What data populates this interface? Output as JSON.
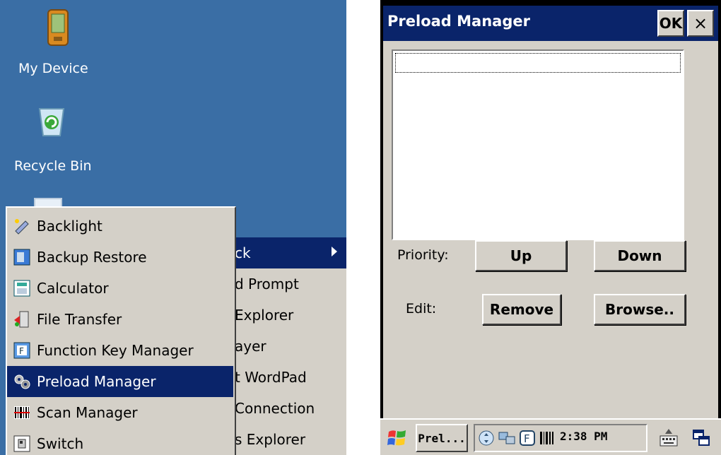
{
  "desktop": {
    "icons": [
      {
        "label": "My Device",
        "icon": "pda-icon"
      },
      {
        "label": "Recycle Bin",
        "icon": "recycle-bin-icon"
      }
    ]
  },
  "submenu": {
    "items": [
      "ck",
      "d Prompt",
      "Explorer",
      "ayer",
      "t WordPad",
      "Connection",
      "s Explorer"
    ],
    "highlight": "#0a246a"
  },
  "start_menu": {
    "items": [
      {
        "label": "Backlight",
        "icon": "backlight-icon"
      },
      {
        "label": "Backup Restore",
        "icon": "backup-restore-icon"
      },
      {
        "label": "Calculator",
        "icon": "calculator-icon"
      },
      {
        "label": "File Transfer",
        "icon": "file-transfer-icon"
      },
      {
        "label": "Function Key Manager",
        "icon": "function-key-icon"
      },
      {
        "label": "Preload Manager",
        "icon": "preload-manager-icon",
        "selected": true
      },
      {
        "label": "Scan Manager",
        "icon": "barcode-icon"
      },
      {
        "label": "Switch",
        "icon": "switch-icon"
      }
    ]
  },
  "window": {
    "title": "Preload Manager",
    "ok_label": "OK",
    "close_label": "×",
    "priority_label": "Priority:",
    "up_label": "Up",
    "down_label": "Down",
    "edit_label": "Edit:",
    "remove_label": "Remove",
    "browse_label": "Browse.."
  },
  "taskbar": {
    "task_button_label": "Prel...",
    "clock": "2:38 PM",
    "tray_icons": [
      "sync-icon",
      "network-icon",
      "function-key-f-icon",
      "barcode-scanner-icon"
    ],
    "keyboard_icon": "keyboard-icon",
    "window_switch_icon": "window-switch-icon"
  },
  "colors": {
    "desktop": "#3a6ea5",
    "titlebar": "#0a246a",
    "face": "#d4d0c8"
  }
}
